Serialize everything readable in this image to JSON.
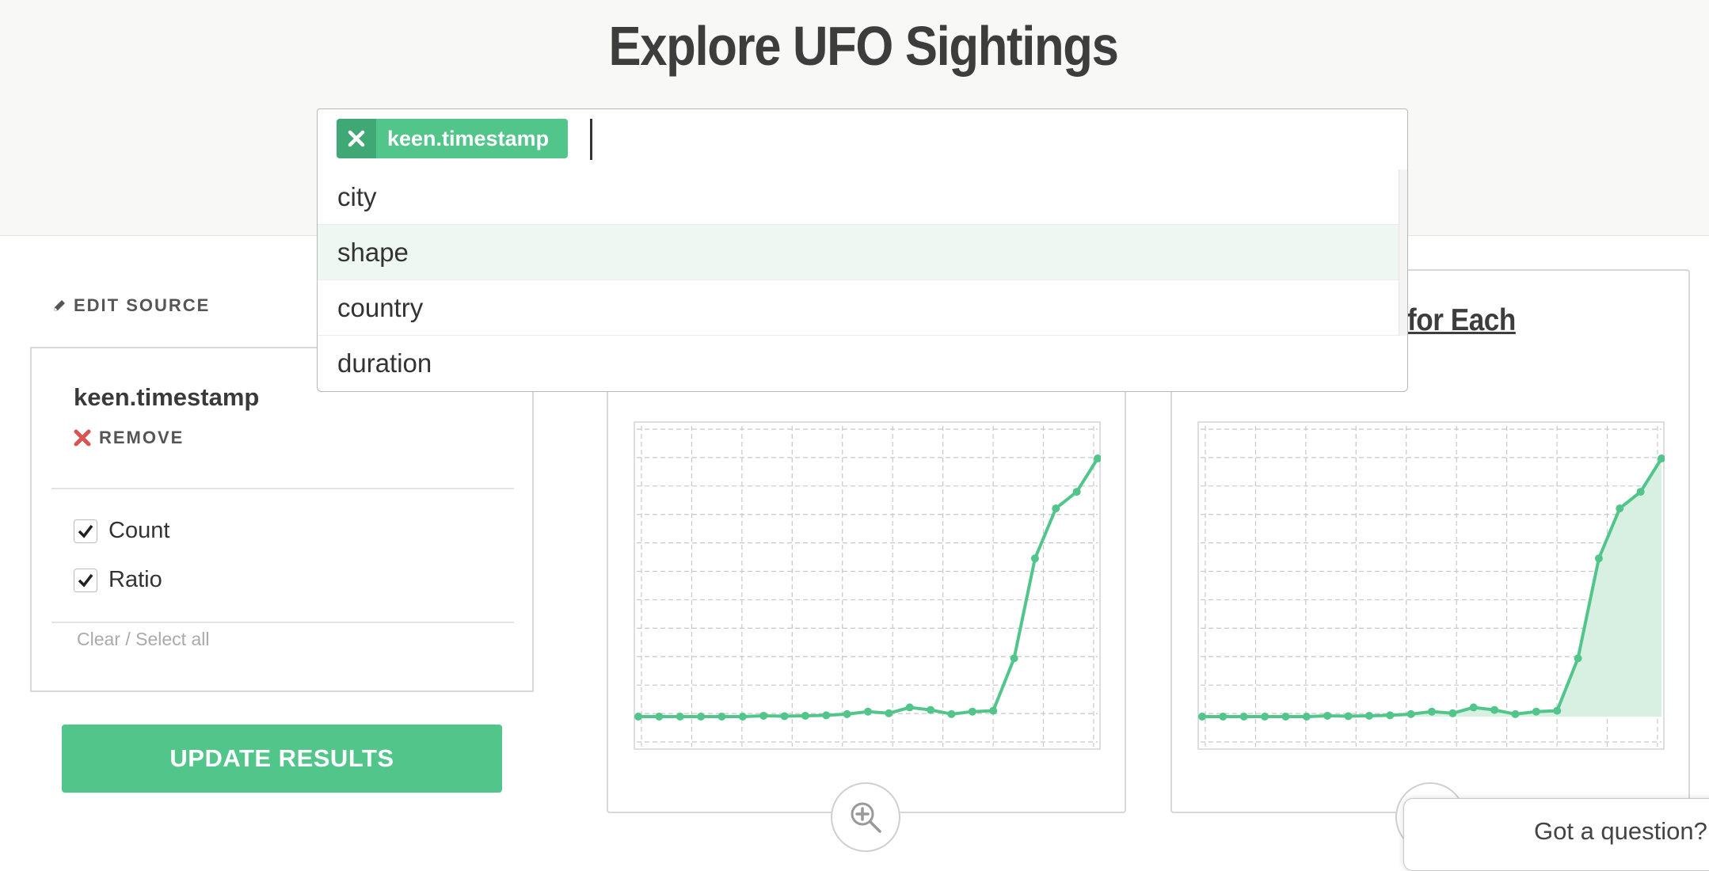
{
  "page": {
    "title": "Explore UFO Sightings"
  },
  "filter": {
    "token": "keen.timestamp",
    "options": [
      "city",
      "shape",
      "country",
      "duration"
    ],
    "highlighted": "shape"
  },
  "sidebar": {
    "edit_source": "EDIT SOURCE",
    "property": "keen.timestamp",
    "remove": "REMOVE",
    "metrics": [
      {
        "label": "Count",
        "checked": true
      },
      {
        "label": "Ratio",
        "checked": true
      }
    ],
    "clear_select": "Clear / Select all",
    "update_button": "UPDATE RESULTS"
  },
  "cards": {
    "right_title_fragment": "for Each"
  },
  "help": {
    "text": "Got a question?"
  },
  "colors": {
    "accent": "#52c58b",
    "accent_dark": "#3fa874",
    "remove_red": "#d9534f",
    "fill": "#d7f0e2"
  },
  "chart_data": [
    {
      "type": "line",
      "title": "",
      "x": [
        1,
        2,
        3,
        4,
        5,
        6,
        7,
        8,
        9,
        10,
        11,
        12,
        13,
        14,
        15,
        16,
        17,
        18,
        19,
        20,
        21,
        22,
        23,
        24
      ],
      "values": [
        0,
        0,
        0,
        0,
        0,
        0,
        0.2,
        0.1,
        0.2,
        0.3,
        0.6,
        1.2,
        0.8,
        2.2,
        1.6,
        0.6,
        1.2,
        1.4,
        14,
        38,
        50,
        54,
        62
      ],
      "ylim": [
        0,
        66
      ],
      "grid": true
    },
    {
      "type": "area",
      "title": "",
      "x": [
        1,
        2,
        3,
        4,
        5,
        6,
        7,
        8,
        9,
        10,
        11,
        12,
        13,
        14,
        15,
        16,
        17,
        18,
        19,
        20,
        21,
        22,
        23,
        24
      ],
      "values": [
        0,
        0,
        0,
        0,
        0,
        0,
        0.2,
        0.1,
        0.2,
        0.3,
        0.6,
        1.2,
        0.8,
        2.2,
        1.6,
        0.6,
        1.2,
        1.4,
        14,
        38,
        50,
        54,
        62
      ],
      "ylim": [
        0,
        66
      ],
      "grid": true
    }
  ]
}
